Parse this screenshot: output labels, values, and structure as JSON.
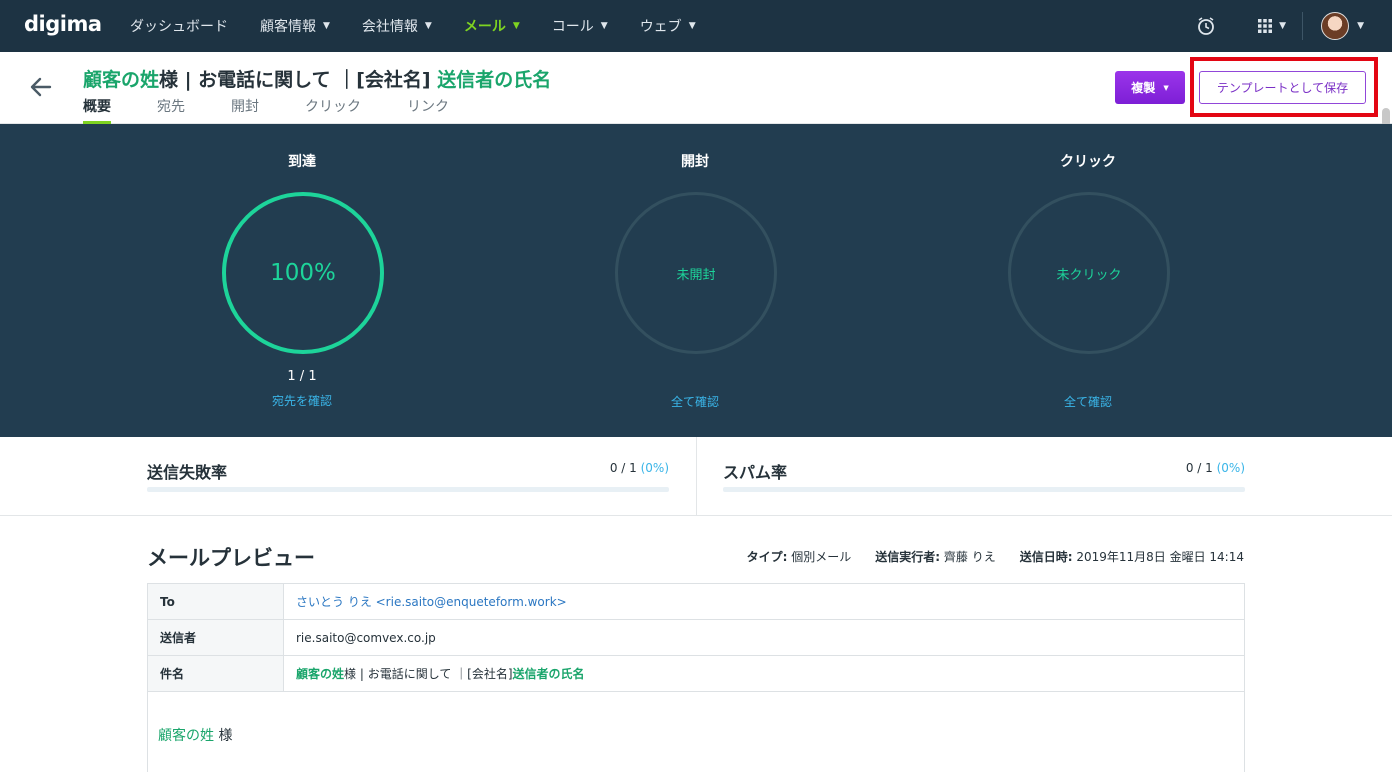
{
  "nav": {
    "logo": "digima",
    "items": [
      {
        "label": "ダッシュボード",
        "has_menu": false
      },
      {
        "label": "顧客情報",
        "has_menu": true
      },
      {
        "label": "会社情報",
        "has_menu": true
      },
      {
        "label": "メール",
        "has_menu": true,
        "active": true
      },
      {
        "label": "コール",
        "has_menu": true
      },
      {
        "label": "ウェブ",
        "has_menu": true
      }
    ],
    "icons": [
      "alarm-clock-icon",
      "apps-grid-icon",
      "avatar"
    ]
  },
  "header": {
    "title_part1": "顧客の姓",
    "title_part2": "様 | お電話に関して ｜[会社名] ",
    "title_part3": "送信者の氏名",
    "tabs": [
      "概要",
      "宛先",
      "開封",
      "クリック",
      "リンク"
    ],
    "active_tab": "概要",
    "duplicate_button": "複製",
    "save_template_button": "テンプレートとして保存"
  },
  "stats": {
    "delivered": {
      "label": "到達",
      "value": "100%",
      "count": "1 / 1",
      "link": "宛先を確認"
    },
    "opened": {
      "label": "開封",
      "value": "未開封",
      "link": "全て確認"
    },
    "clicked": {
      "label": "クリック",
      "value": "未クリック",
      "link": "全て確認"
    }
  },
  "rates": {
    "failure": {
      "label": "送信失敗率",
      "value": "0 / 1",
      "pct": "(0%)"
    },
    "spam": {
      "label": "スパム率",
      "value": "0 / 1",
      "pct": "(0%)"
    }
  },
  "preview": {
    "title": "メールプレビュー",
    "type_label": "タイプ:",
    "type_value": "個別メール",
    "sender_label": "送信実行者:",
    "sender_value": "齊藤 りえ",
    "date_label": "送信日時:",
    "date_value": "2019年11月8日 金曜日 14:14",
    "rows": {
      "to_key": "To",
      "to_value": "さいとう りえ <rie.saito@enqueteform.work>",
      "from_key": "送信者",
      "from_value": "rie.saito@comvex.co.jp",
      "subject_key": "件名",
      "subject_part1": "顧客の姓",
      "subject_part2": "様 | お電話に関して ｜[会社名] ",
      "subject_part3": "送信者の氏名"
    },
    "greeting_name": "顧客の姓",
    "greeting_suffix": " 様"
  },
  "colors": {
    "nav_bg": "#1d3343",
    "stats_bg": "#223d50",
    "accent_green": "#1aa56b",
    "ring_green": "#1dd49a",
    "nav_active": "#7ed321",
    "purple": "#8a2be2",
    "highlight_red": "#e30613",
    "link_blue": "#3ab5e8"
  }
}
